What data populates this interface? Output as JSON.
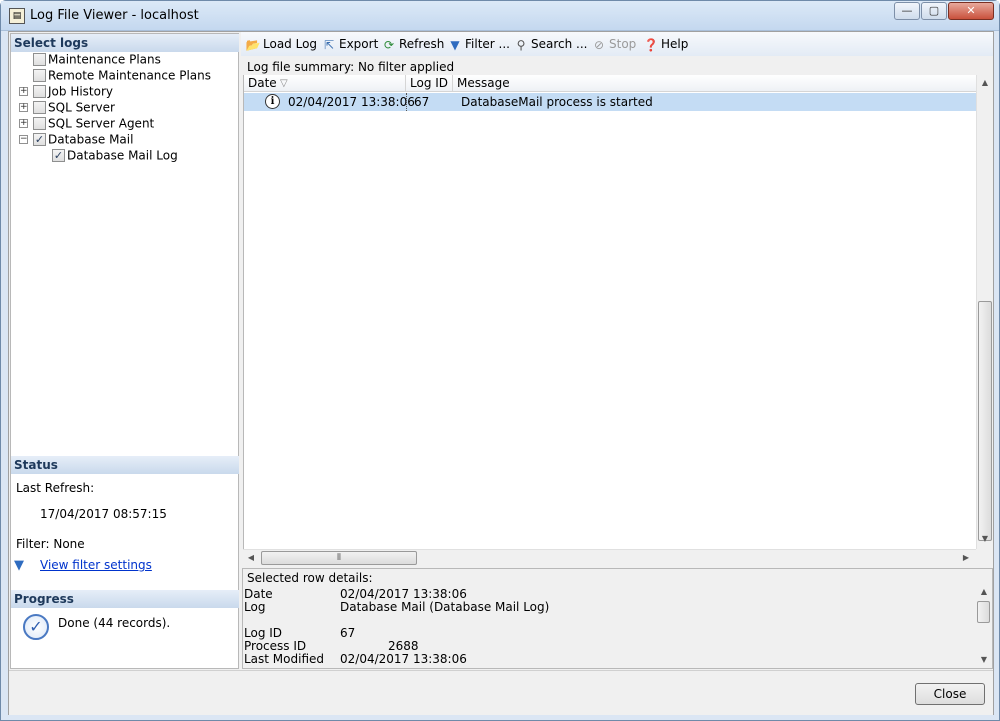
{
  "window": {
    "title": "Log File Viewer - localhost",
    "app_icon": "log-viewer-icon",
    "controls": {
      "minimize": "—",
      "maximize": "▢",
      "close": "✕"
    }
  },
  "select_logs": {
    "header": "Select logs",
    "items": [
      {
        "label": "Maintenance Plans",
        "checked": false,
        "expander": "",
        "level": 1
      },
      {
        "label": "Remote Maintenance Plans",
        "checked": false,
        "expander": "",
        "level": 1
      },
      {
        "label": "Job History",
        "checked": false,
        "expander": "+",
        "level": 1
      },
      {
        "label": "SQL Server",
        "checked": false,
        "expander": "+",
        "level": 1
      },
      {
        "label": "SQL Server Agent",
        "checked": false,
        "expander": "+",
        "level": 1
      },
      {
        "label": "Database Mail",
        "checked": true,
        "expander": "−",
        "level": 1
      },
      {
        "label": "Database Mail Log",
        "checked": true,
        "expander": "",
        "level": 2
      }
    ],
    "check_glyph": "✓"
  },
  "status": {
    "header": "Status",
    "last_refresh_label": "Last Refresh:",
    "last_refresh_value": "17/04/2017 08:57:15",
    "filter_label": "Filter: None",
    "view_filter_link": "View filter settings"
  },
  "progress": {
    "header": "Progress",
    "text": "Done (44 records).",
    "icon": "check-circle-icon"
  },
  "toolbar": {
    "load_log": "Load Log",
    "export": "Export",
    "refresh": "Refresh",
    "filter": "Filter ...",
    "search": "Search ...",
    "stop": "Stop",
    "help": "Help"
  },
  "summary": "Log file summary: No filter applied",
  "grid": {
    "columns": {
      "date": "Date",
      "log_id": "Log ID",
      "message": "Message"
    },
    "sort_glyph": "▽",
    "rows": [
      {
        "date": "02/04/2017 13:38:06",
        "log_id": "67",
        "message": "DatabaseMail process is started",
        "icon": "info-icon"
      }
    ]
  },
  "details": {
    "header": "Selected row details:",
    "date_label": "Date",
    "date_value": "02/04/2017 13:38:06",
    "log_label": "Log",
    "log_value": "Database Mail (Database Mail Log)",
    "log_id_label": "Log ID",
    "log_id_value": "67",
    "process_id_label": "Process ID",
    "process_id_value": "2688",
    "last_modified_label": "Last Modified",
    "last_modified_value": "02/04/2017 13:38:06"
  },
  "close_button": "Close",
  "colors": {
    "selection": "#c4dcf4",
    "section_header": "#c9d9ec",
    "link": "#0033cc"
  }
}
